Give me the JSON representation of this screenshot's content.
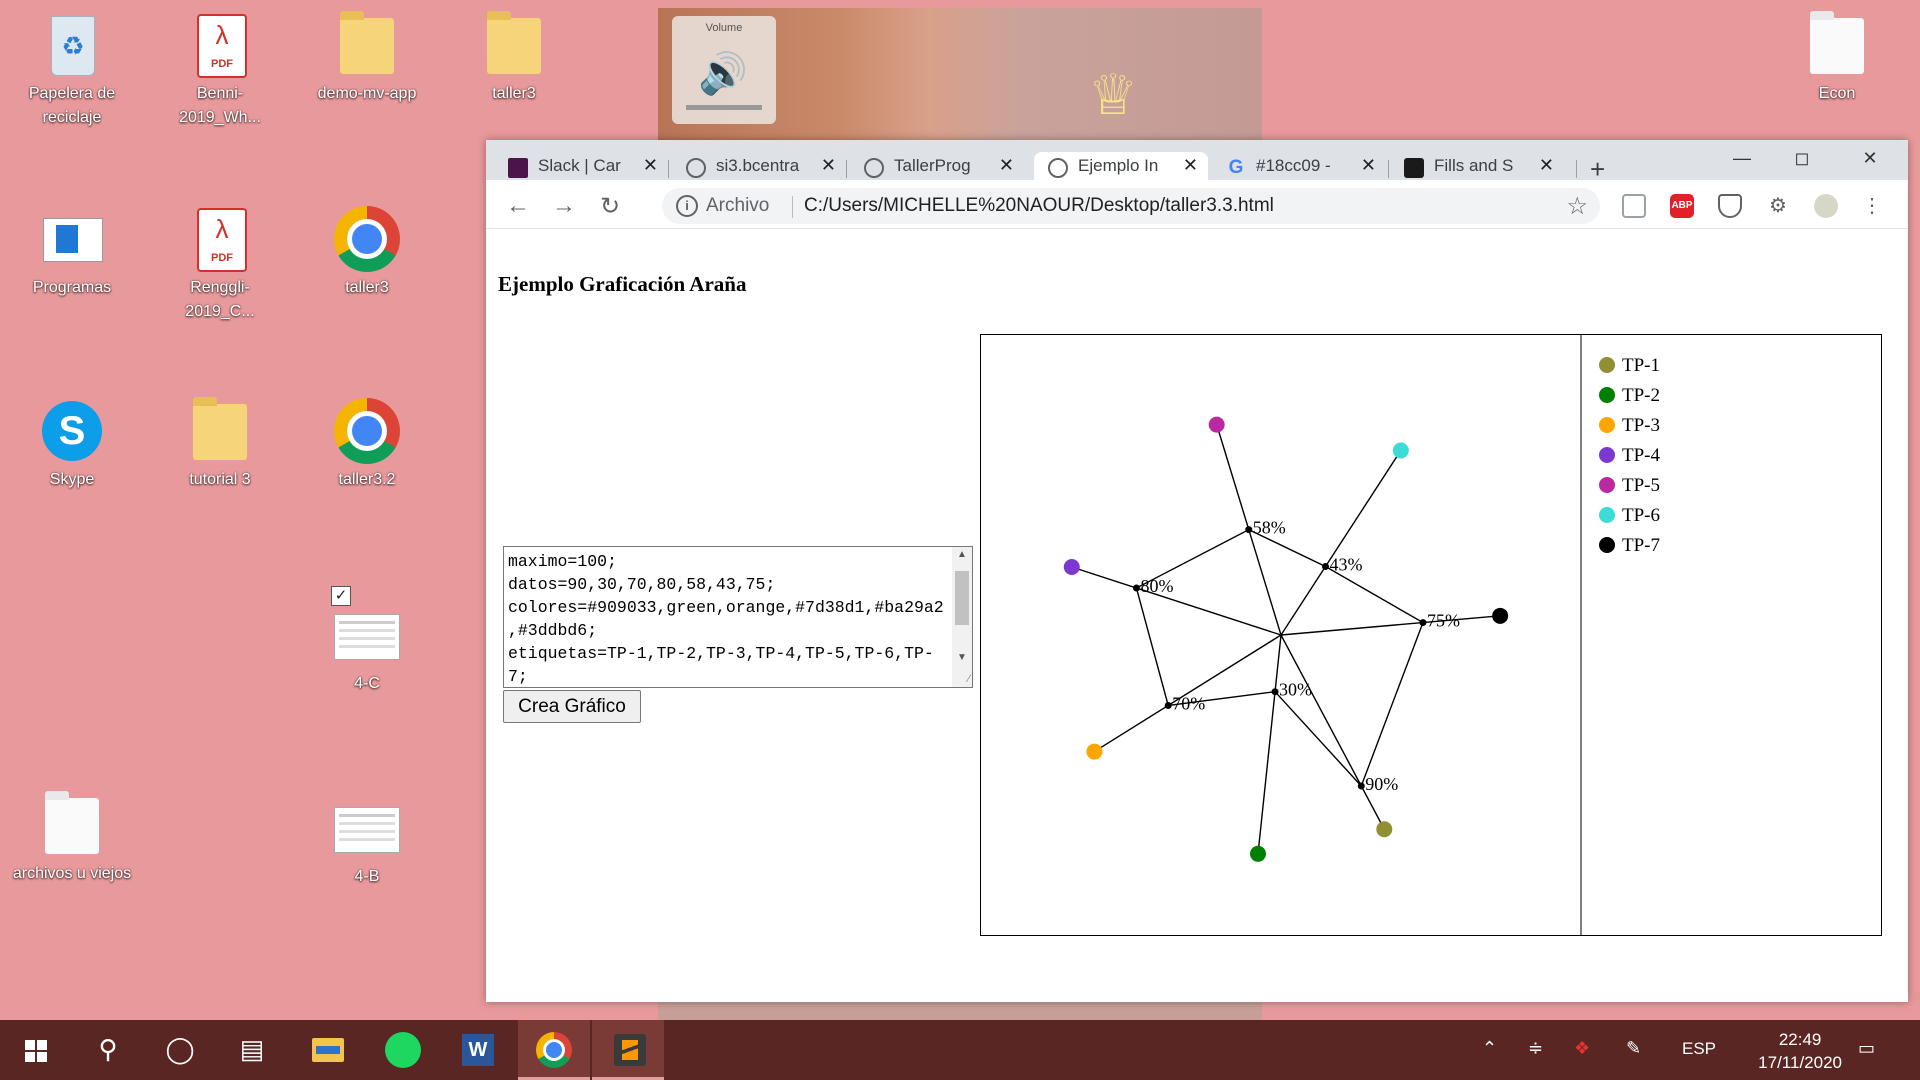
{
  "desktop": {
    "icons": [
      {
        "label": "Papelera de reciclaje",
        "icon": "recycle-bin"
      },
      {
        "label": "Benni-2019_Wh...",
        "icon": "pdf-file"
      },
      {
        "label": "demo-mv-app",
        "icon": "folder"
      },
      {
        "label": "taller3",
        "icon": "folder"
      },
      {
        "label": "Econ",
        "icon": "folder"
      },
      {
        "label": "Programas",
        "icon": "programs-shortcut"
      },
      {
        "label": "Renggli-2019_C...",
        "icon": "pdf-file"
      },
      {
        "label": "taller3",
        "icon": "chrome"
      },
      {
        "label": "Skype",
        "icon": "skype"
      },
      {
        "label": "tutorial 3",
        "icon": "folder"
      },
      {
        "label": "taller3.2",
        "icon": "chrome"
      },
      {
        "label": "4-C",
        "icon": "document-thumbnail"
      },
      {
        "label": "archivos u viejos",
        "icon": "folder"
      },
      {
        "label": "4-B",
        "icon": "document-thumbnail"
      }
    ],
    "wallpaper_overlay": {
      "volume_label": "Volume"
    }
  },
  "browser": {
    "tabs": [
      {
        "title": "Slack | Car",
        "icon": "slack-icon"
      },
      {
        "title": "si3.bcentra",
        "icon": "globe-icon"
      },
      {
        "title": "TallerProg",
        "icon": "globe-icon"
      },
      {
        "title": "Ejemplo In",
        "icon": "globe-icon",
        "active": true
      },
      {
        "title": "#18cc09 -",
        "icon": "google-icon"
      },
      {
        "title": "Fills and S",
        "icon": "fills-icon"
      }
    ],
    "address": {
      "chip": "Archivo",
      "url": "C:/Users/MICHELLE%20NAOUR/Desktop/taller3.3.html"
    },
    "extensions": [
      "pocket-icon",
      "adblock-plus-icon",
      "shield-icon",
      "puzzle-icon",
      "avatar-icon",
      "menu-icon"
    ],
    "extension_labels": {
      "abp": "ABP"
    }
  },
  "page": {
    "title": "Ejemplo Graficación Araña",
    "config_text": "maximo=100;\ndatos=90,30,70,80,58,43,75;\ncolores=#909033,green,orange,#7d38d1,#ba29a2,#3ddbd6;\netiquetas=TP-1,TP-2,TP-3,TP-4,TP-5,TP-6,TP-7;",
    "button_label": "Crea Gráfico"
  },
  "chart_data": {
    "type": "radar",
    "max": 100,
    "categories": [
      "TP-1",
      "TP-2",
      "TP-3",
      "TP-4",
      "TP-5",
      "TP-6",
      "TP-7"
    ],
    "values": [
      90,
      30,
      70,
      80,
      58,
      43,
      75
    ],
    "value_labels": [
      "90%",
      "30%",
      "70%",
      "80%",
      "58%",
      "43%",
      "75%"
    ],
    "colors": [
      "#909033",
      "green",
      "orange",
      "#7d38d1",
      "#ba29a2",
      "#3ddbd6",
      "#000000"
    ],
    "legend": [
      "TP-1",
      "TP-2",
      "TP-3",
      "TP-4",
      "TP-5",
      "TP-6",
      "TP-7"
    ],
    "legend_position": "right"
  },
  "taskbar": {
    "apps": [
      "windows-start-icon",
      "search-icon",
      "cortana-icon",
      "task-view-icon",
      "file-explorer-icon",
      "spotify-icon",
      "word-icon",
      "chrome-icon",
      "sublime-icon"
    ],
    "language": "ESP",
    "time": "22:49",
    "date": "17/11/2020"
  }
}
